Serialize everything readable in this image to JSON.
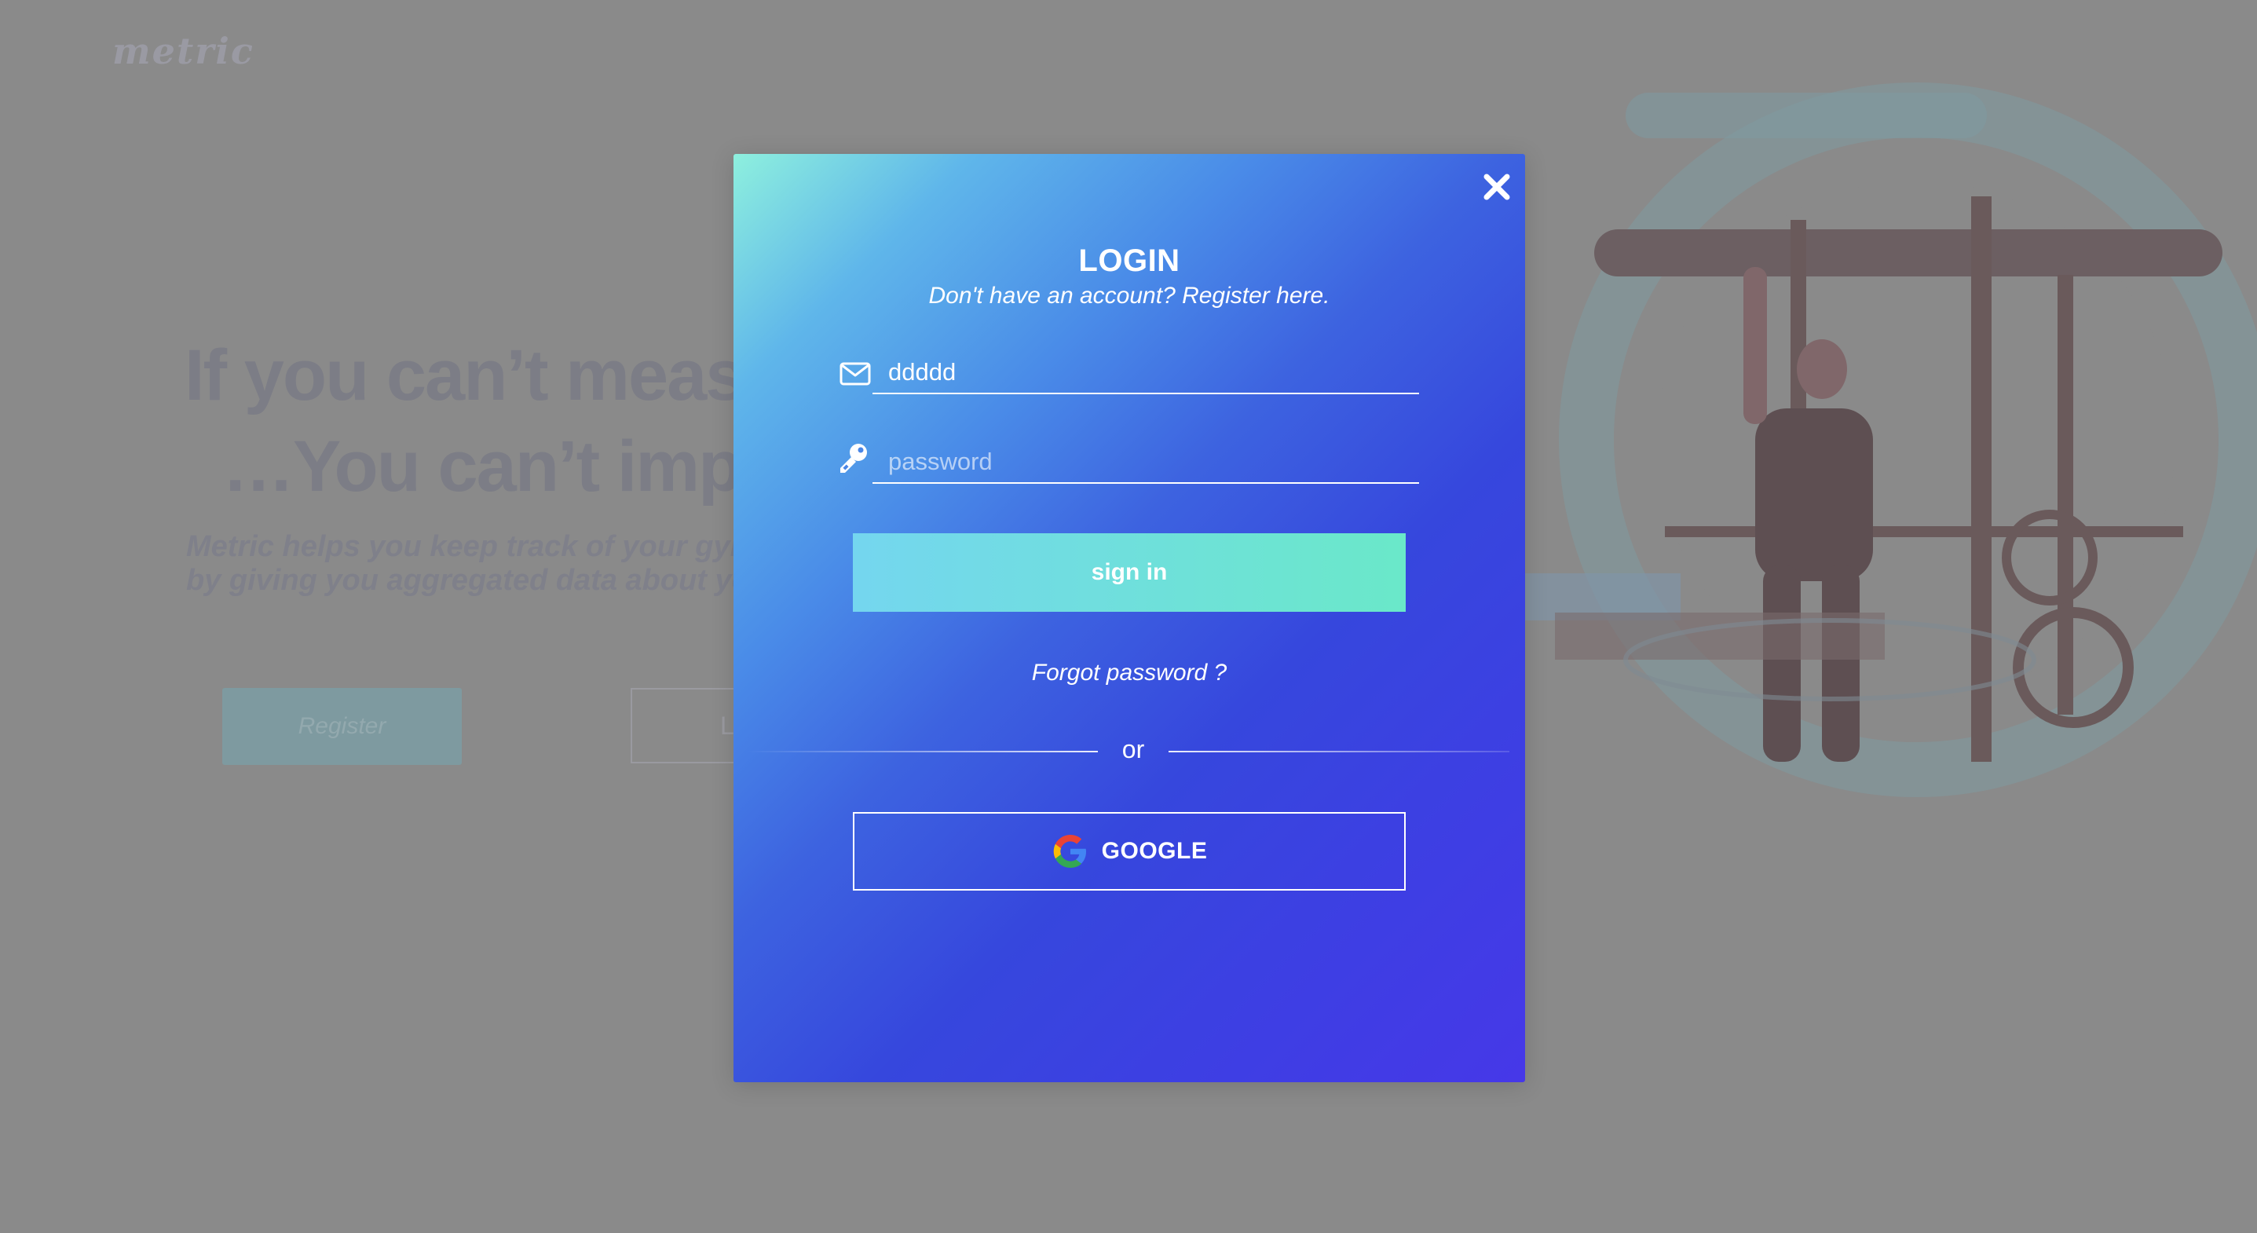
{
  "background": {
    "logo": "metric",
    "headline_line1": "If you can’t measure it",
    "headline_line2": "…You can’t improve it",
    "tagline_line1": "Metric helps you keep track of your gym",
    "tagline_line2": "by giving you aggregated data about your",
    "register_button": "Register",
    "login_button": "Login"
  },
  "modal": {
    "title": "LOGIN",
    "subtitle": "Don't have an account? Register here.",
    "email": {
      "value": "ddddd",
      "icon": "envelope-icon"
    },
    "password": {
      "value": "",
      "placeholder": "password",
      "icon": "key-icon"
    },
    "signin_label": "sign in",
    "forgot_label": "Forgot password ?",
    "divider_label": "or",
    "google_label": "GOOGLE",
    "close_icon": "close-icon"
  },
  "colors": {
    "gradient_start": "#8ef0de",
    "gradient_mid": "#3647dd",
    "gradient_end": "#4638e8",
    "signin_start": "#74d6ef",
    "signin_end": "#6ae8c9",
    "overlay": "#8a8a8a"
  }
}
